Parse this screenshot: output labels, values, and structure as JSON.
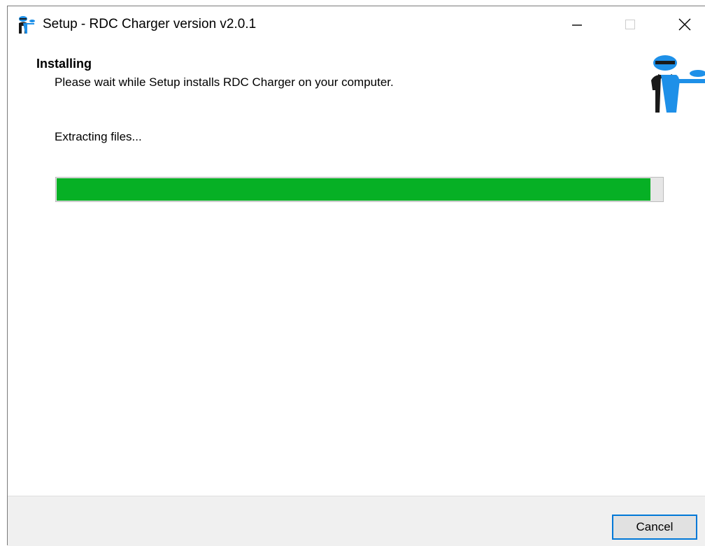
{
  "window": {
    "title": "Setup - RDC Charger version v2.0.1"
  },
  "header": {
    "title": "Installing",
    "subtitle": "Please wait while Setup installs RDC Charger on your computer."
  },
  "status": {
    "text": "Extracting files..."
  },
  "progress": {
    "percent": 98
  },
  "footer": {
    "cancel_label": "Cancel"
  },
  "icons": {
    "app": "app-butler-icon",
    "logo": "butler-logo",
    "minimize": "minimize-icon",
    "maximize": "maximize-icon",
    "close": "close-icon"
  },
  "colors": {
    "progress_fill": "#06b025",
    "progress_track": "#e6e6e6",
    "focus_border": "#0078d7",
    "footer_background": "#f0f0f0",
    "logo_blue": "#1e90e8"
  }
}
